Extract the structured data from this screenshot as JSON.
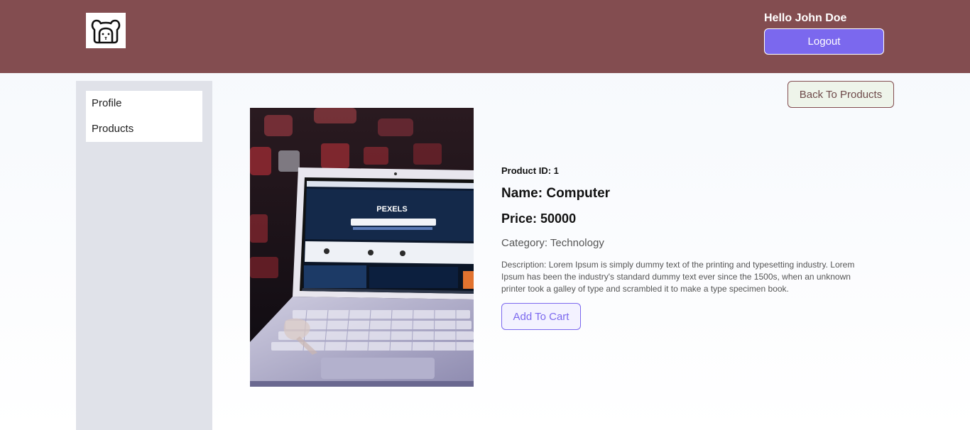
{
  "header": {
    "logo_icon": "bear-logo-icon",
    "greeting": "Hello John Doe",
    "logout_label": "Logout",
    "background_color": "#834d50",
    "button_color": "#7b68ee"
  },
  "sidebar": {
    "items": [
      {
        "label": "Profile"
      },
      {
        "label": "Products"
      }
    ]
  },
  "main": {
    "back_label": "Back To Products",
    "product": {
      "image_alt": "laptop-photo",
      "id_text": "Product ID: 1",
      "name_text": "Name: Computer",
      "price_text": "Price: 50000",
      "category_text": "Category: Technology",
      "description_text": "Description: Lorem Ipsum is simply dummy text of the printing and typesetting industry. Lorem Ipsum has been the industry's standard dummy text ever since the 1500s, when an unknown printer took a galley of type and scrambled it to make a type specimen book.",
      "screen_text": "PEXELS"
    },
    "add_to_cart_label": "Add To Cart"
  }
}
